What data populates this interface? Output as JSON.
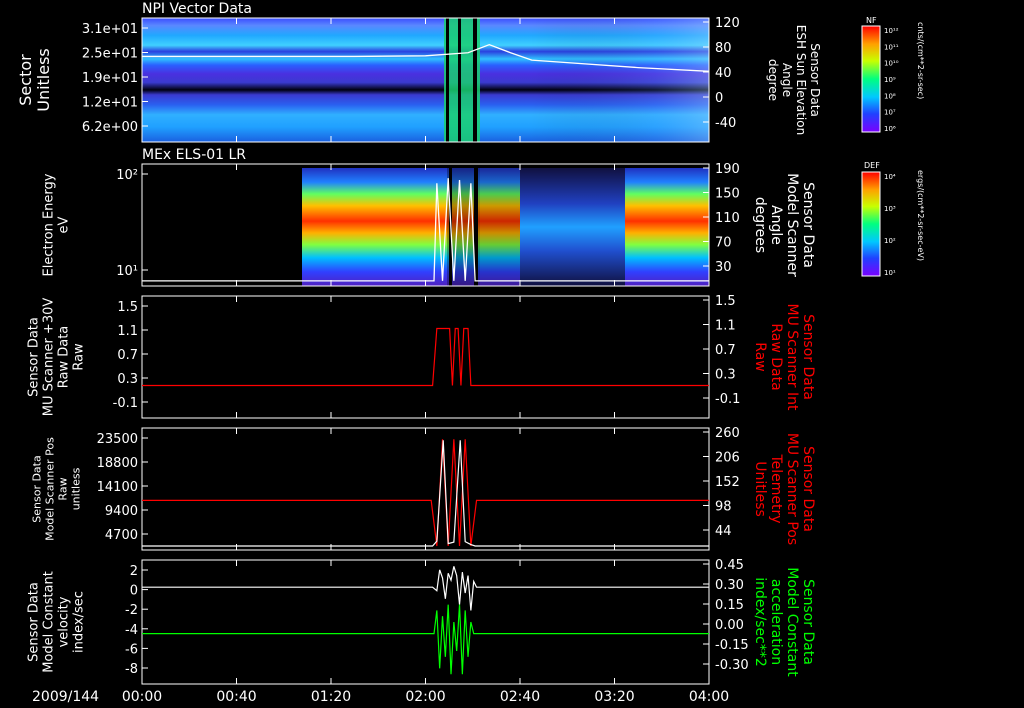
{
  "date_label": "2009/144",
  "time_ticks": [
    "00:00",
    "00:40",
    "01:20",
    "02:00",
    "02:40",
    "03:20",
    "04:00"
  ],
  "colors": {
    "axes": "#ffffff",
    "red_trace": "#ff0000",
    "green_trace": "#00ff00",
    "white_trace": "#ffffff"
  },
  "colorbars": [
    {
      "label": "NF",
      "units": "cnts/(cm**2-sr-sec)",
      "ticks": [
        "10¹²",
        "10¹¹",
        "10¹⁰",
        "10⁹",
        "10⁸",
        "10⁷",
        "10⁶"
      ]
    },
    {
      "label": "DEF",
      "units": "ergs/(cm**2-sr-sec-eV)",
      "ticks": [
        "10⁴",
        "10³",
        "10²",
        "10¹"
      ]
    }
  ],
  "chart_data": [
    {
      "type": "heatmap",
      "title": "NPI Vector Data",
      "ylabel_left": [
        "Sector",
        "Unitless"
      ],
      "ylabel_right": [
        "Sensor Data",
        "ESH Sun Elevation",
        "Angle",
        "degree"
      ],
      "yticks_left": [
        "3.1e+01",
        "2.5e+01",
        "1.9e+01",
        "1.2e+01",
        "6.2e+00"
      ],
      "yticks_right": [
        "120",
        "80",
        "40",
        "0",
        "-40"
      ],
      "right_range": [
        -80,
        120
      ],
      "overlay_white": {
        "x": [
          0,
          1.5,
          2.0,
          2.3,
          2.45,
          2.6,
          2.75,
          3.0,
          3.5,
          4.0
        ],
        "y": [
          58,
          58,
          59,
          64,
          77,
          64,
          52,
          48,
          40,
          34
        ]
      }
    },
    {
      "type": "heatmap",
      "title": "MEx ELS-01 LR",
      "ylabel_left": [
        "Electron Energy",
        "eV"
      ],
      "ylabel_right": [
        "Sensor Data",
        "Model Scanner",
        "Angle",
        "degrees"
      ],
      "yticks_left": [
        "10²",
        "10¹"
      ],
      "yticks_right": [
        "190",
        "150",
        "110",
        "70",
        "30"
      ],
      "right_range": [
        0,
        190
      ],
      "overlay_white": {
        "x": [
          0,
          2.06,
          2.08,
          2.12,
          2.16,
          2.2,
          2.24,
          2.28,
          2.32,
          2.35,
          4.0
        ],
        "y": [
          8,
          8,
          160,
          8,
          168,
          8,
          165,
          8,
          160,
          8,
          8
        ]
      }
    },
    {
      "type": "line",
      "ylabel_left": [
        "Sensor Data",
        "MU Scanner +30V",
        "Raw Data",
        "Raw"
      ],
      "ylabel_right": [
        "Sensor Data",
        "MU Scanner Int",
        "Raw Data",
        "Raw"
      ],
      "yticks_left": [
        "1.5",
        "1.1",
        "0.7",
        "0.3",
        "-0.1"
      ],
      "yticks_right": [
        "1.5",
        "1.1",
        "0.7",
        "0.3",
        "-0.1"
      ],
      "ylim": [
        -0.5,
        1.5
      ],
      "series": [
        {
          "color": "red",
          "x": [
            0,
            2.05,
            2.08,
            2.17,
            2.19,
            2.21,
            2.23,
            2.25,
            2.27,
            2.29,
            2.3,
            2.32,
            2.35,
            4.0
          ],
          "y": [
            0,
            0,
            1,
            1,
            0,
            1,
            1,
            0,
            1,
            1,
            1,
            0,
            0,
            0
          ]
        }
      ]
    },
    {
      "type": "line",
      "ylabel_left": [
        "Sensor Data",
        "Model Scanner Pos",
        "Raw",
        "unitless"
      ],
      "ylabel_right": [
        "Sensor Data",
        "MU Scanner Pos",
        "Telemetry",
        "Unitless"
      ],
      "yticks_left": [
        "23500",
        "18800",
        "14100",
        "9400",
        "4700"
      ],
      "yticks_right": [
        "260",
        "206",
        "152",
        "98",
        "44"
      ],
      "ylim": [
        0,
        23500
      ],
      "series": [
        {
          "color": "red",
          "x": [
            0,
            2.04,
            2.08,
            2.12,
            2.16,
            2.2,
            2.24,
            2.28,
            2.32,
            2.36,
            4.0
          ],
          "y": [
            9400,
            9400,
            0,
            22000,
            0,
            22000,
            0,
            22000,
            0,
            9400,
            9400
          ]
        },
        {
          "color": "white",
          "x": [
            0,
            2.05,
            2.08,
            2.125,
            2.16,
            2.2,
            2.245,
            2.28,
            2.32,
            2.35,
            4.0
          ],
          "y": [
            0,
            0,
            1000,
            21800,
            500,
            800,
            21800,
            900,
            300,
            0,
            0
          ]
        }
      ]
    },
    {
      "type": "line",
      "ylabel_left": [
        "Sensor Data",
        "Model Constant",
        "velocity",
        "index/sec"
      ],
      "ylabel_right": [
        "Sensor Data",
        "Model Constant",
        "acceleration",
        "index/sec**2"
      ],
      "yticks_left": [
        "2",
        "0",
        "-2",
        "-4",
        "-6",
        "-8"
      ],
      "yticks_right": [
        "0.45",
        "0.30",
        "0.15",
        "0.00",
        "-0.15",
        "-0.30"
      ],
      "ylim": [
        -8,
        2
      ],
      "series": [
        {
          "color": "white",
          "x": [
            0,
            2.05,
            2.08,
            2.1,
            2.12,
            2.14,
            2.16,
            2.18,
            2.2,
            2.22,
            2.24,
            2.26,
            2.28,
            2.3,
            2.32,
            2.34,
            2.36,
            4.0
          ],
          "y": [
            0,
            0,
            -0.3,
            1.5,
            0.8,
            -1,
            1.2,
            0.6,
            1.8,
            1,
            -1.5,
            1.3,
            -0.5,
            1,
            -2,
            0.5,
            0,
            0
          ]
        },
        {
          "color": "green",
          "x": [
            0,
            2.06,
            2.08,
            2.1,
            2.12,
            2.14,
            2.16,
            2.18,
            2.2,
            2.22,
            2.24,
            2.26,
            2.28,
            2.3,
            2.32,
            2.34,
            4.0
          ],
          "y": [
            -4,
            -4,
            -2,
            -7,
            -2.5,
            -6,
            -1.5,
            -7.5,
            -3,
            -5.5,
            -1.5,
            -7.5,
            -2,
            -6,
            -3,
            -4,
            -4
          ]
        }
      ]
    }
  ]
}
